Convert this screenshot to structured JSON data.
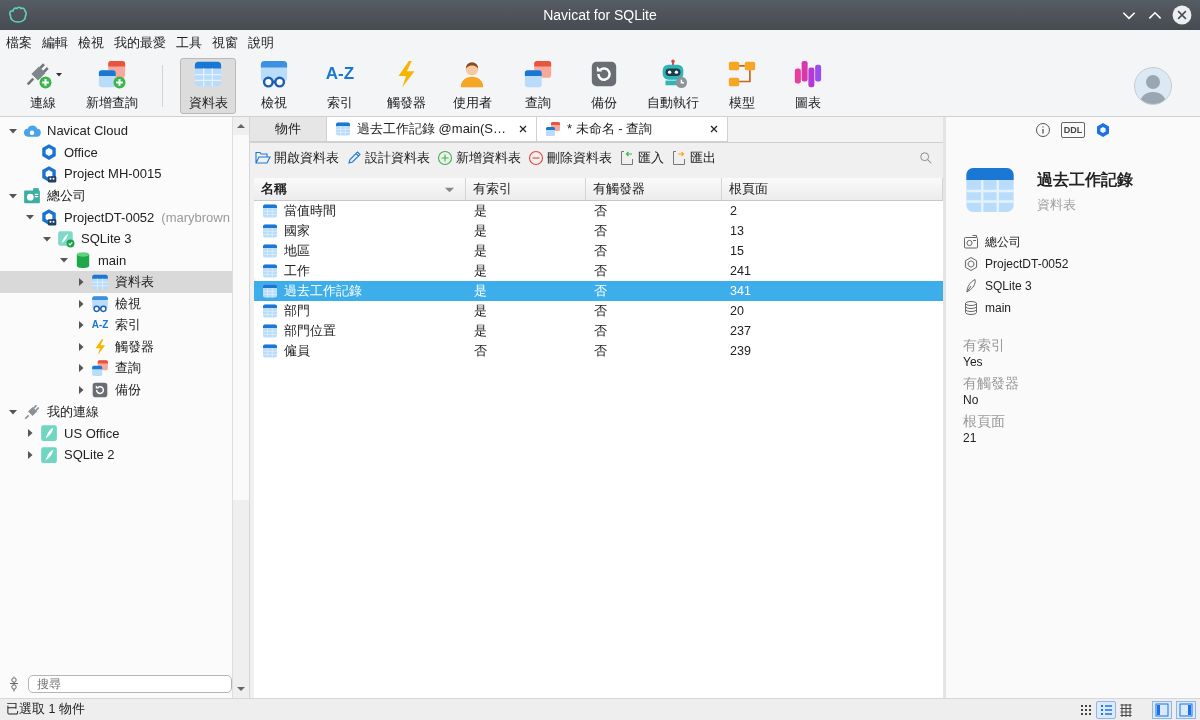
{
  "window": {
    "title": "Navicat for SQLite"
  },
  "menu": [
    "檔案",
    "編輯",
    "檢視",
    "我的最愛",
    "工具",
    "視窗",
    "說明"
  ],
  "toolbar": {
    "connection_tools": [
      {
        "label": "連線",
        "kind": "connection",
        "dropdown": true
      },
      {
        "label": "新增查詢",
        "kind": "new-query"
      }
    ],
    "object_tools": [
      {
        "label": "資料表",
        "kind": "table",
        "selected": true
      },
      {
        "label": "檢視",
        "kind": "view",
        "selected": false
      },
      {
        "label": "索引",
        "kind": "index",
        "glyph": "A-Z",
        "selected": false
      },
      {
        "label": "觸發器",
        "kind": "trigger",
        "selected": false
      },
      {
        "label": "使用者",
        "kind": "user",
        "selected": false
      },
      {
        "label": "查詢",
        "kind": "query",
        "selected": false
      },
      {
        "label": "備份",
        "kind": "backup",
        "selected": false
      },
      {
        "label": "自動執行",
        "kind": "automation",
        "selected": false
      },
      {
        "label": "模型",
        "kind": "model",
        "selected": false
      },
      {
        "label": "圖表",
        "kind": "chart",
        "selected": false
      }
    ]
  },
  "sidebar": {
    "tree": [
      {
        "label": "Navicat Cloud",
        "kind": "cloud",
        "expanded": true,
        "selected": false,
        "children": [
          {
            "label": "Office",
            "kind": "hexagon",
            "selected": false
          },
          {
            "label": "Project MH-0015",
            "kind": "project",
            "selected": false
          }
        ]
      },
      {
        "label": "總公司",
        "kind": "company",
        "expanded": true,
        "selected": false,
        "children": [
          {
            "label": "ProjectDT-0052",
            "note": "(marybrown",
            "kind": "project",
            "expanded": true,
            "selected": false,
            "children": [
              {
                "label": "SQLite 3",
                "kind": "sqlite-ok",
                "expanded": true,
                "selected": false,
                "children": [
                  {
                    "label": "main",
                    "kind": "database",
                    "expanded": true,
                    "selected": false,
                    "children": [
                      {
                        "label": "資料表",
                        "kind": "table",
                        "expanded": false,
                        "selected": true
                      },
                      {
                        "label": "檢視",
                        "kind": "view",
                        "expanded": false,
                        "selected": false
                      },
                      {
                        "label": "索引",
                        "kind": "index",
                        "glyph": "A-Z",
                        "expanded": false,
                        "selected": false
                      },
                      {
                        "label": "觸發器",
                        "kind": "trigger",
                        "expanded": false,
                        "selected": false
                      },
                      {
                        "label": "查詢",
                        "kind": "query",
                        "expanded": false,
                        "selected": false
                      },
                      {
                        "label": "備份",
                        "kind": "backup",
                        "expanded": false,
                        "selected": false
                      }
                    ]
                  }
                ]
              }
            ]
          }
        ]
      },
      {
        "label": "我的連線",
        "kind": "plug",
        "expanded": true,
        "selected": false,
        "children": [
          {
            "label": "US Office",
            "kind": "feather",
            "expanded": false,
            "selected": false
          },
          {
            "label": "SQLite 2",
            "kind": "feather",
            "expanded": false,
            "selected": false
          }
        ]
      }
    ],
    "search": {
      "placeholder": "搜尋"
    }
  },
  "center": {
    "tabs": [
      {
        "label": "物件",
        "kind": "objects",
        "selected": true
      },
      {
        "label": "過去工作記錄 @main(S…",
        "kind": "table",
        "closable": true,
        "selected": false
      },
      {
        "label": "* 未命名 - 查詢",
        "kind": "query",
        "closable": true,
        "selected": false
      }
    ],
    "actions": [
      {
        "label": "開啟資料表",
        "kind": "open"
      },
      {
        "label": "設計資料表",
        "kind": "design"
      },
      {
        "label": "新增資料表",
        "kind": "add"
      },
      {
        "label": "刪除資料表",
        "kind": "delete"
      },
      {
        "label": "匯入",
        "kind": "import"
      },
      {
        "label": "匯出",
        "kind": "export"
      }
    ],
    "table": {
      "columns": [
        {
          "label": "名稱",
          "sorted": true
        },
        {
          "label": "有索引",
          "sorted": false
        },
        {
          "label": "有觸發器",
          "sorted": false
        },
        {
          "label": "根頁面",
          "sorted": false
        }
      ],
      "rows": [
        {
          "cells": [
            "當值時間",
            "是",
            "否",
            "2"
          ],
          "selected": false
        },
        {
          "cells": [
            "國家",
            "是",
            "否",
            "13"
          ],
          "selected": false
        },
        {
          "cells": [
            "地區",
            "是",
            "否",
            "15"
          ],
          "selected": false
        },
        {
          "cells": [
            "工作",
            "是",
            "否",
            "241"
          ],
          "selected": false
        },
        {
          "cells": [
            "過去工作記錄",
            "是",
            "否",
            "341"
          ],
          "selected": true
        },
        {
          "cells": [
            "部門",
            "是",
            "否",
            "20"
          ],
          "selected": false
        },
        {
          "cells": [
            "部門位置",
            "是",
            "否",
            "237"
          ],
          "selected": false
        },
        {
          "cells": [
            "僱員",
            "否",
            "否",
            "239"
          ],
          "selected": false
        }
      ]
    }
  },
  "info_panel": {
    "tabs": [
      {
        "kind": "info",
        "selected": false
      },
      {
        "kind": "ddl",
        "glyph": "DDL",
        "selected": false
      },
      {
        "kind": "object",
        "selected": true
      }
    ],
    "title": "過去工作記錄",
    "subtitle": "資料表",
    "path": [
      {
        "kind": "company",
        "label": "總公司"
      },
      {
        "kind": "project",
        "label": "ProjectDT-0052"
      },
      {
        "kind": "sqlite",
        "label": "SQLite 3"
      },
      {
        "kind": "database",
        "label": "main"
      }
    ],
    "properties": [
      {
        "label": "有索引",
        "value": "Yes"
      },
      {
        "label": "有觸發器",
        "value": "No"
      },
      {
        "label": "根頁面",
        "value": "21"
      }
    ]
  },
  "status_bar": {
    "text": "已選取 1 物件",
    "view_modes": [
      {
        "kind": "icons",
        "selected": false
      },
      {
        "kind": "list",
        "selected": true
      },
      {
        "kind": "detail",
        "selected": false
      }
    ],
    "panels": [
      {
        "kind": "left",
        "on": true
      },
      {
        "kind": "right",
        "on": true
      }
    ]
  }
}
